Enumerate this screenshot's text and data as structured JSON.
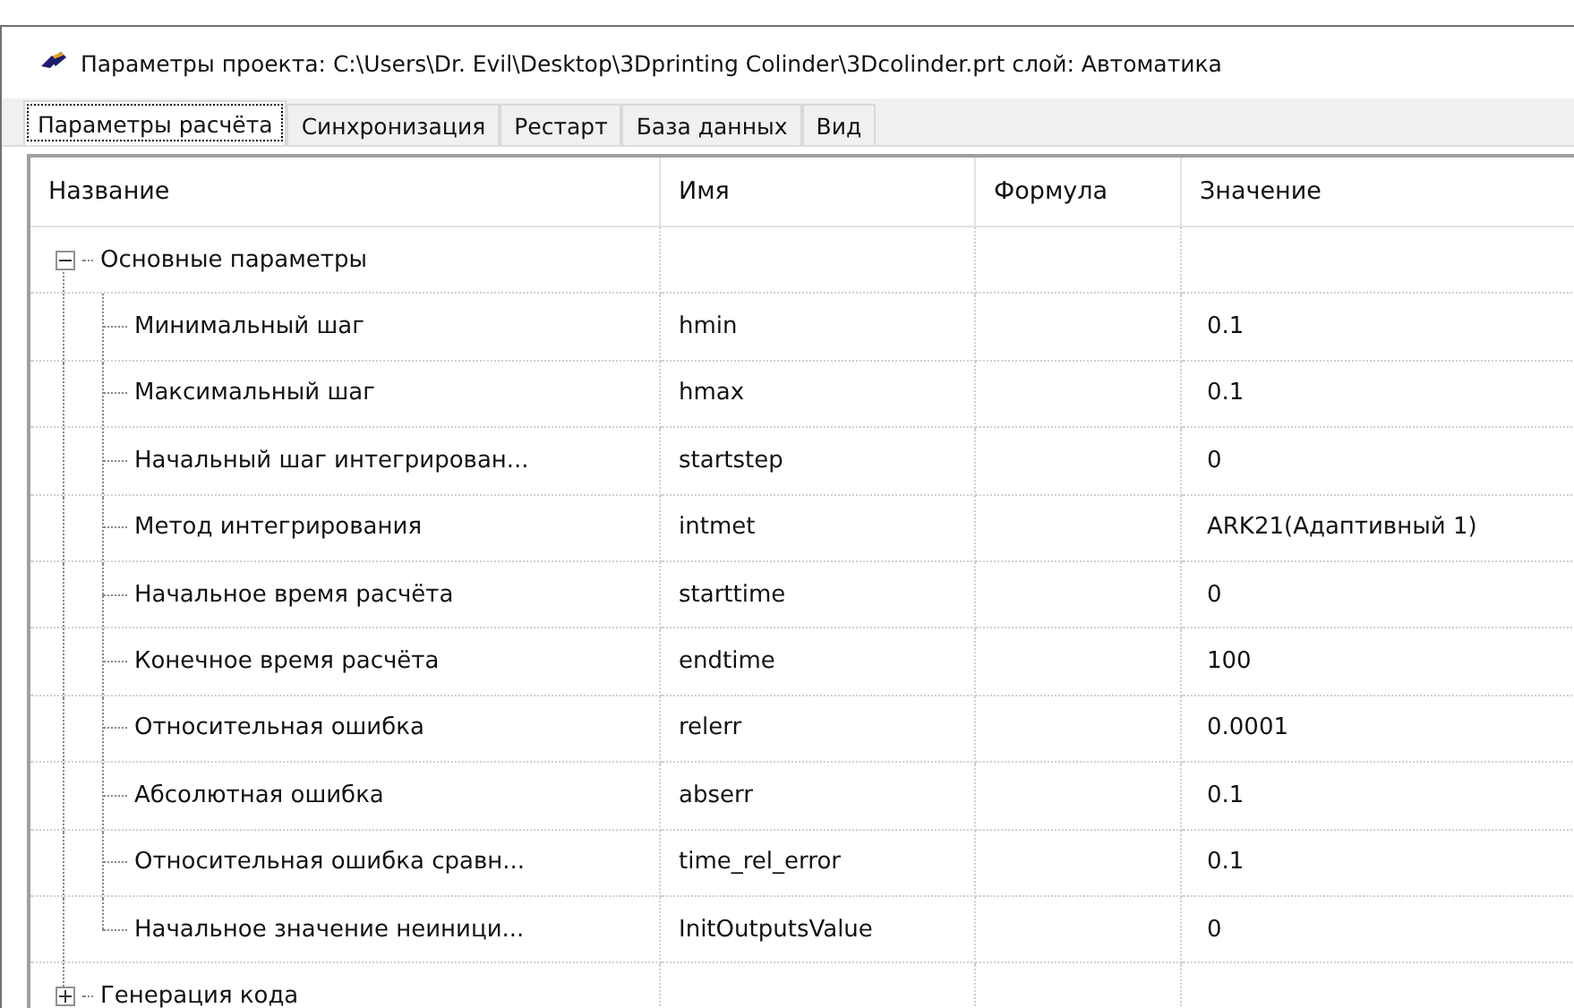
{
  "window": {
    "title": "Параметры проекта: C:\\Users\\Dr. Evil\\Desktop\\3Dprinting Colinder\\3Dcolinder.prt  слой: Автоматика"
  },
  "tabs": [
    {
      "label": "Параметры расчёта",
      "selected": true
    },
    {
      "label": "Синхронизация",
      "selected": false
    },
    {
      "label": "Рестарт",
      "selected": false
    },
    {
      "label": "База данных",
      "selected": false
    },
    {
      "label": "Вид",
      "selected": false
    }
  ],
  "table": {
    "columns": [
      "Название",
      "Имя",
      "Формула",
      "Значение"
    ],
    "rows": [
      {
        "name": "Основные параметры",
        "expanded": true,
        "children": [
          {
            "name": "Минимальный шаг",
            "id": "hmin",
            "value": "0.1"
          },
          {
            "name": "Максимальный шаг",
            "id": "hmax",
            "value": "0.1"
          },
          {
            "name": "Начальный шаг интегрирован...",
            "id": "startstep",
            "value": "0"
          },
          {
            "name": "Метод интегрирования",
            "id": "intmet",
            "value": "ARK21(Адаптивный 1)"
          },
          {
            "name": "Начальное время расчёта",
            "id": "starttime",
            "value": "0"
          },
          {
            "name": "Конечное время расчёта",
            "id": "endtime",
            "value": "100"
          },
          {
            "name": "Относительная ошибка",
            "id": "relerr",
            "value": "0.0001"
          },
          {
            "name": "Абсолютная ошибка",
            "id": "abserr",
            "value": "0.1"
          },
          {
            "name": "Относительная ошибка сравн...",
            "id": "time_rel_error",
            "value": "0.1"
          },
          {
            "name": "Начальное значение неиници...",
            "id": "InitOutputsValue",
            "value": "0"
          }
        ]
      },
      {
        "name": "Генерация кода",
        "expanded": false,
        "children": []
      }
    ]
  }
}
